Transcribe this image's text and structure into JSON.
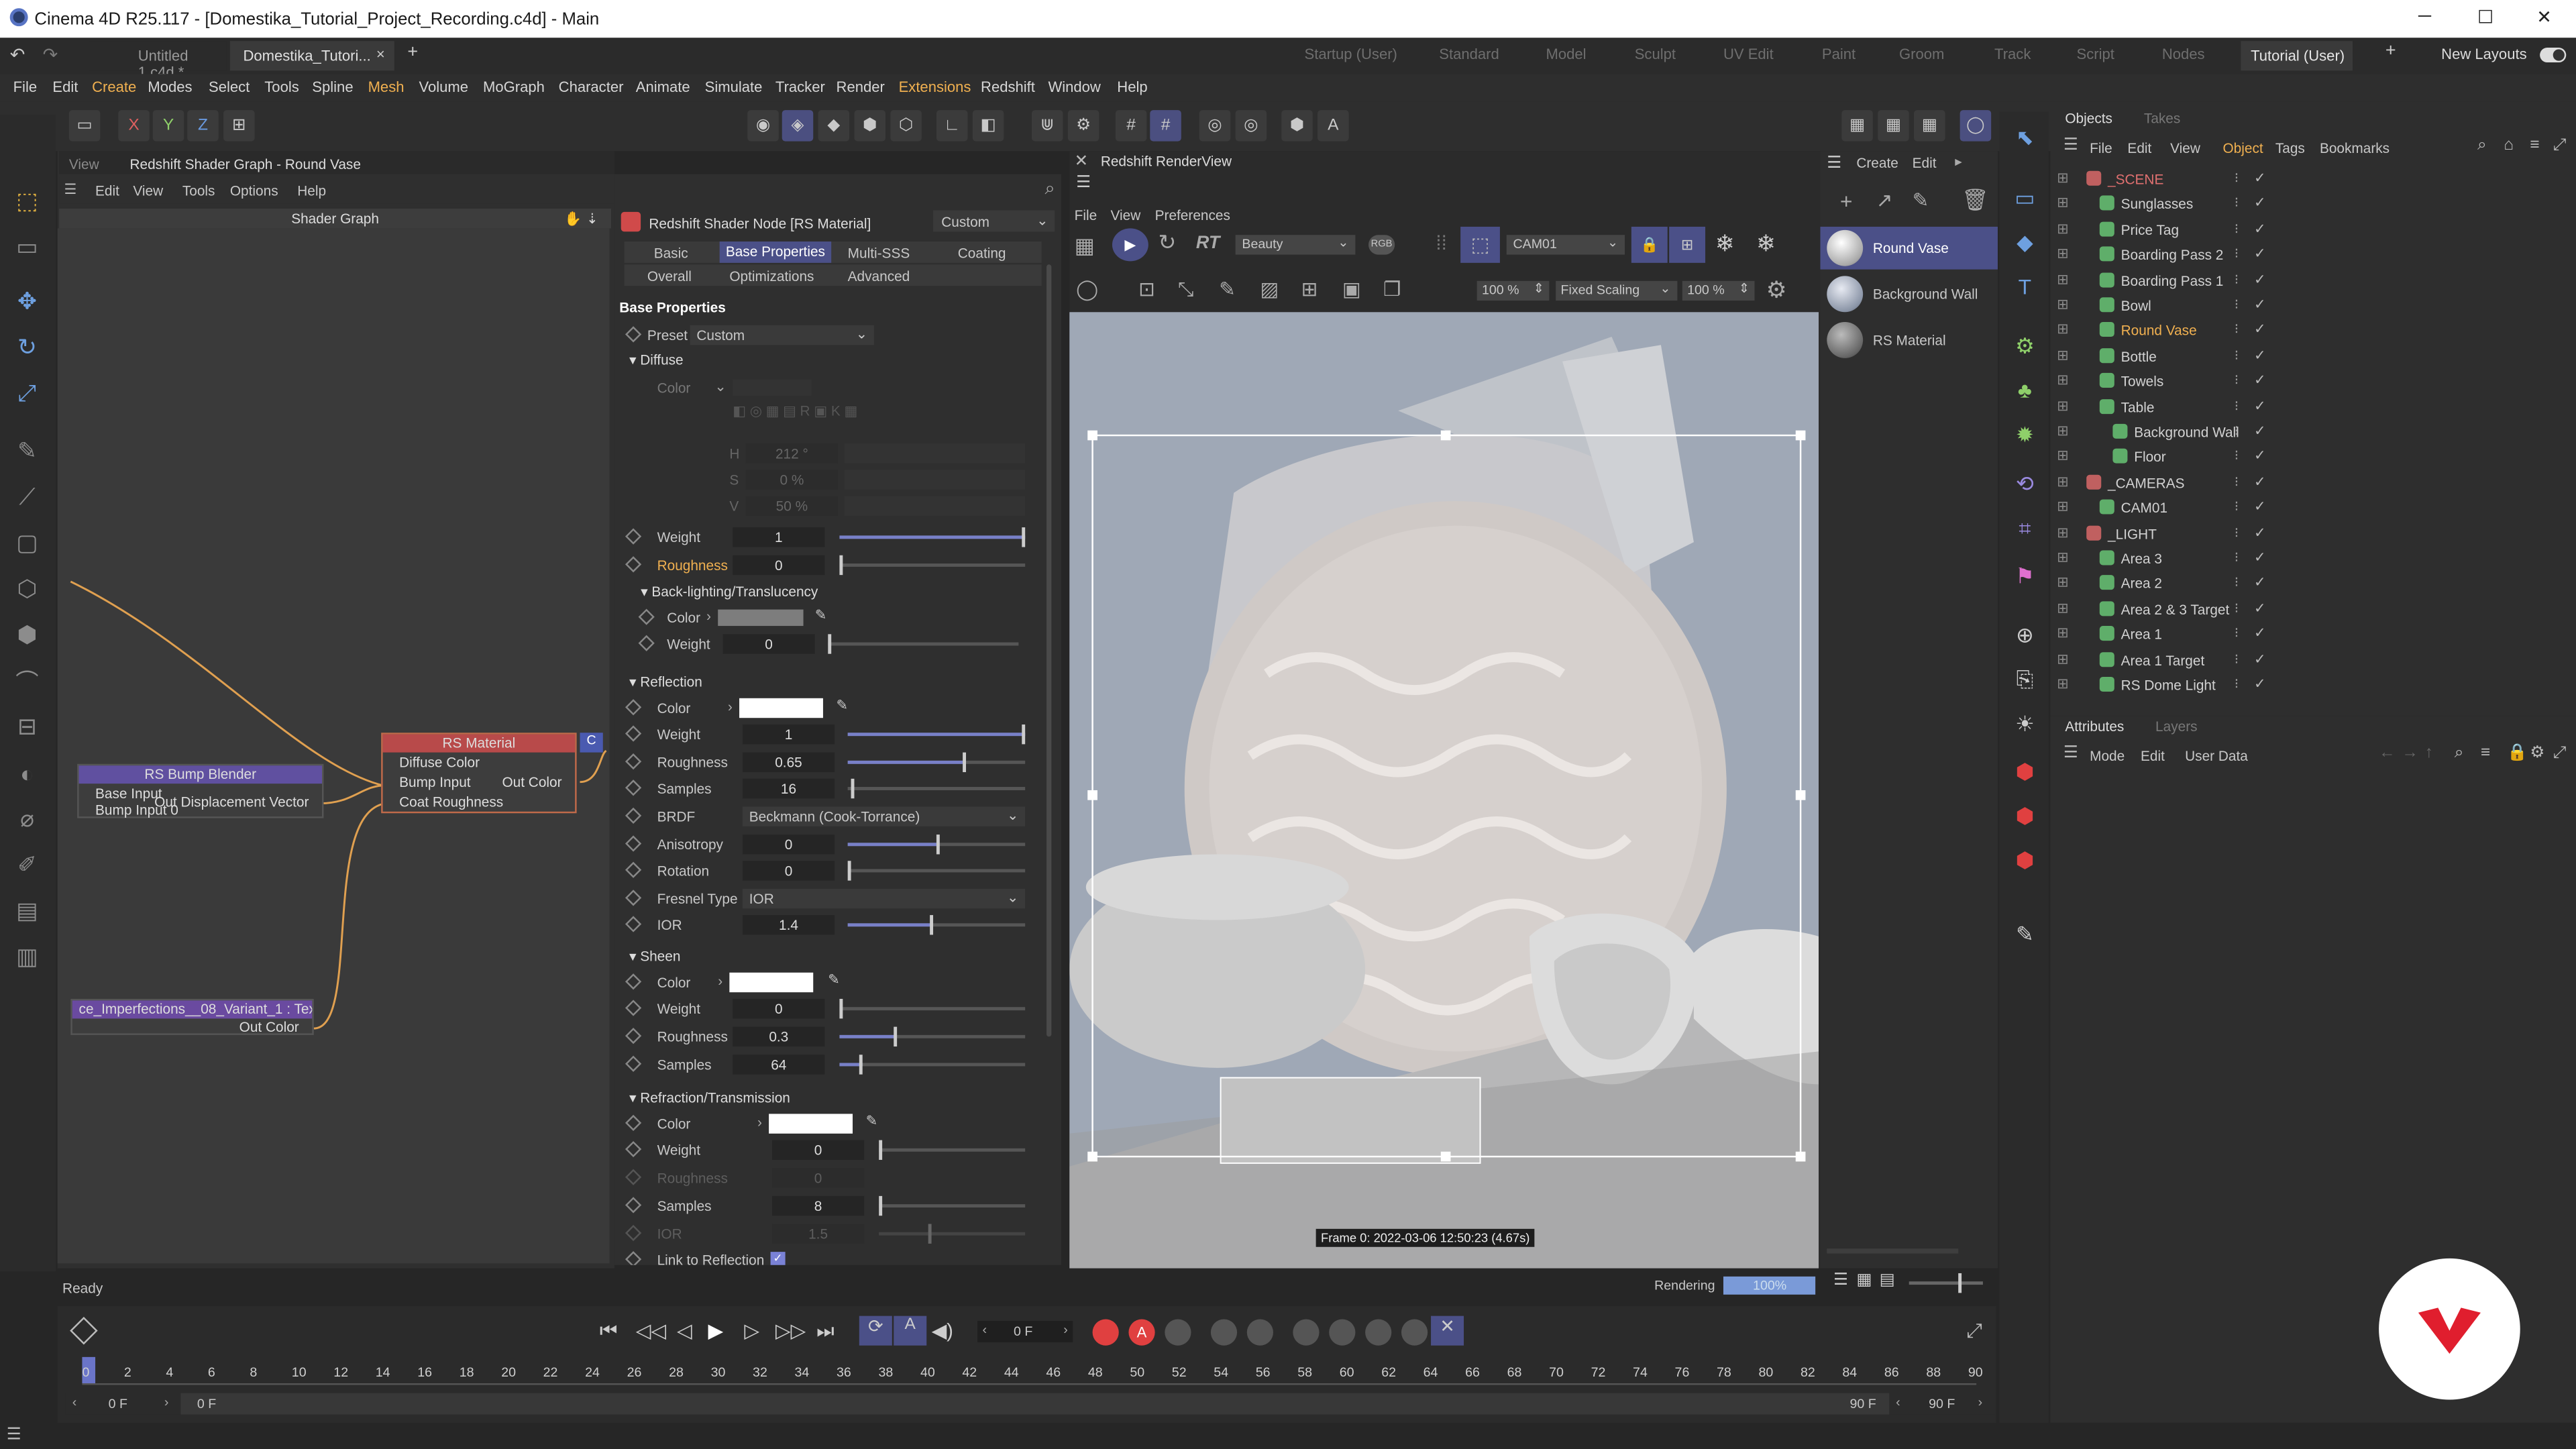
{
  "window": {
    "title": "Cinema 4D R25.117 - [Domestika_Tutorial_Project_Recording.c4d] - Main",
    "controls": [
      "─",
      "☐",
      "✕"
    ]
  },
  "doc_tabs": [
    {
      "label": "Untitled 1.c4d *"
    },
    {
      "label": "Domestika_Tutori..."
    }
  ],
  "doc_tab_close": "×",
  "doc_tab_add": "+",
  "layouts": [
    "Startup (User)",
    "Standard",
    "Model",
    "Sculpt",
    "UV Edit",
    "Paint",
    "Groom",
    "Track",
    "Script",
    "Nodes",
    "Tutorial (User)"
  ],
  "layout_add": "+",
  "new_layouts": "New Layouts",
  "menus": [
    "File",
    "Edit",
    "Create",
    "Modes",
    "Select",
    "Tools",
    "Spline",
    "Mesh",
    "Volume",
    "MoGraph",
    "Character",
    "Animate",
    "Simulate",
    "Tracker",
    "Render",
    "Extensions",
    "Redshift",
    "Window",
    "Help"
  ],
  "axis_buttons": [
    "X",
    "Y",
    "Z"
  ],
  "shader_graph": {
    "tab_view": "View",
    "title": "Redshift Shader Graph - Round Vase",
    "menu": [
      "Edit",
      "View",
      "Tools",
      "Options",
      "Help"
    ],
    "graph_title": "Shader Graph"
  },
  "nodes": {
    "rs_material": {
      "title": "RS Material",
      "ports": [
        "Diffuse Color",
        "Bump Input",
        "Coat Roughness"
      ],
      "out": "Out Color"
    },
    "bump_blender": {
      "title": "RS Bump Blender",
      "ports": [
        "Base Input",
        "Bump Input 0"
      ],
      "out": "Out Displacement Vector"
    },
    "texture": {
      "title": "ce_Imperfections__08_Variant_1 : Tex",
      "out": "Out Color"
    }
  },
  "props": {
    "node_title": "Redshift Shader Node [RS Material]",
    "node_preset": "Custom",
    "tabs_row1": [
      "Basic",
      "Base Properties",
      "Multi-SSS",
      "Coating"
    ],
    "tabs_row2": [
      "Overall",
      "Optimizations",
      "Advanced"
    ],
    "section": "Base Properties",
    "preset_label": "Preset",
    "preset_value": "Custom",
    "diffuse": {
      "header": "Diffuse",
      "color_label": "Color",
      "h": "H",
      "h_val": "212 °",
      "s": "S",
      "s_val": "0 %",
      "v": "V",
      "v_val": "50 %",
      "weight_label": "Weight",
      "weight": "1",
      "rough_label": "Roughness",
      "rough": "0"
    },
    "backlight": {
      "header": "Back-lighting/Translucency",
      "color_label": "Color",
      "weight_label": "Weight",
      "weight": "0"
    },
    "reflection": {
      "header": "Reflection",
      "color_label": "Color",
      "weight_label": "Weight",
      "weight": "1",
      "rough_label": "Roughness",
      "rough": "0.65",
      "samples_label": "Samples",
      "samples": "16",
      "brdf_label": "BRDF",
      "brdf": "Beckmann (Cook-Torrance)",
      "aniso_label": "Anisotropy",
      "aniso": "0",
      "rot_label": "Rotation",
      "rot": "0",
      "fresnel_label": "Fresnel Type",
      "fresnel": "IOR",
      "ior_label": "IOR",
      "ior": "1.4"
    },
    "sheen": {
      "header": "Sheen",
      "color_label": "Color",
      "weight_label": "Weight",
      "weight": "0",
      "rough_label": "Roughness",
      "rough": "0.3",
      "samples_label": "Samples",
      "samples": "64"
    },
    "refraction": {
      "header": "Refraction/Transmission",
      "color_label": "Color",
      "weight_label": "Weight",
      "weight": "0",
      "rough_label": "Roughness",
      "rough": "0",
      "samples_label": "Samples",
      "samples": "8",
      "ior_label": "IOR",
      "ior": "1.5",
      "link_label": "Link to Reflection"
    }
  },
  "renderview": {
    "title": "Redshift RenderView",
    "menu": [
      "File",
      "View",
      "Preferences"
    ],
    "rt": "RT",
    "aov": "Beauty",
    "camera": "CAM01",
    "zoom": "100 %",
    "scaling": "Fixed Scaling",
    "zoom2": "100 %",
    "frame_info": "Frame  0:  2022-03-06  12:50:23  (4.67s)",
    "status": "Rendering",
    "progress": "100%",
    "progress_fraction": 1.0
  },
  "materials": {
    "menu": [
      "Create",
      "Edit"
    ],
    "items": [
      "Round Vase",
      "Background Wall",
      "RS Material"
    ]
  },
  "objects": {
    "tabs": [
      "Objects",
      "Takes"
    ],
    "menu": [
      "File",
      "Edit",
      "View",
      "Object",
      "Tags",
      "Bookmarks"
    ],
    "rows": [
      {
        "name": "_SCENE",
        "color": "#e07070",
        "indent": 0
      },
      {
        "name": "Sunglasses",
        "color": "#d2d2d2",
        "indent": 1
      },
      {
        "name": "Price Tag",
        "color": "#d2d2d2",
        "indent": 1
      },
      {
        "name": "Boarding Pass 2",
        "color": "#d2d2d2",
        "indent": 1
      },
      {
        "name": "Boarding Pass 1",
        "color": "#d2d2d2",
        "indent": 1
      },
      {
        "name": "Bowl",
        "color": "#d2d2d2",
        "indent": 1
      },
      {
        "name": "Round Vase",
        "color": "#f0b050",
        "indent": 1
      },
      {
        "name": "Bottle",
        "color": "#d2d2d2",
        "indent": 1
      },
      {
        "name": "Towels",
        "color": "#d2d2d2",
        "indent": 1
      },
      {
        "name": "Table",
        "color": "#d2d2d2",
        "indent": 1
      },
      {
        "name": "Background Wall",
        "color": "#d2d2d2",
        "indent": 2
      },
      {
        "name": "Floor",
        "color": "#d2d2d2",
        "indent": 2
      },
      {
        "name": "_CAMERAS",
        "color": "#d2d2d2",
        "indent": 0
      },
      {
        "name": "CAM01",
        "color": "#d2d2d2",
        "indent": 1
      },
      {
        "name": "_LIGHT",
        "color": "#d2d2d2",
        "indent": 0
      },
      {
        "name": "Area 3",
        "color": "#d2d2d2",
        "indent": 1
      },
      {
        "name": "Area 2",
        "color": "#d2d2d2",
        "indent": 1
      },
      {
        "name": "Area 2 & 3 Target",
        "color": "#d2d2d2",
        "indent": 1
      },
      {
        "name": "Area 1",
        "color": "#d2d2d2",
        "indent": 1
      },
      {
        "name": "Area 1 Target",
        "color": "#d2d2d2",
        "indent": 1
      },
      {
        "name": "RS Dome Light",
        "color": "#d2d2d2",
        "indent": 1
      }
    ]
  },
  "attributes": {
    "tabs": [
      "Attributes",
      "Layers"
    ],
    "menu": [
      "Mode",
      "Edit",
      "User Data"
    ]
  },
  "status": "Ready",
  "timeline": {
    "current": "0 F",
    "start": "0 F",
    "start2": "0 F",
    "end": "90 F",
    "end2": "90 F",
    "ticks": [
      "0",
      "2",
      "4",
      "6",
      "8",
      "10",
      "12",
      "14",
      "16",
      "18",
      "20",
      "22",
      "24",
      "26",
      "28",
      "30",
      "32",
      "34",
      "36",
      "38",
      "40",
      "42",
      "44",
      "46",
      "48",
      "50",
      "52",
      "54",
      "56",
      "58",
      "60",
      "62",
      "64",
      "66",
      "68",
      "70",
      "72",
      "74",
      "76",
      "78",
      "80",
      "82",
      "84",
      "86",
      "88",
      "90"
    ]
  },
  "colors": {
    "accent": "#7a82d6",
    "selected_object": "#f0b050",
    "record": "#e04040",
    "brand": "#e01e2e"
  }
}
